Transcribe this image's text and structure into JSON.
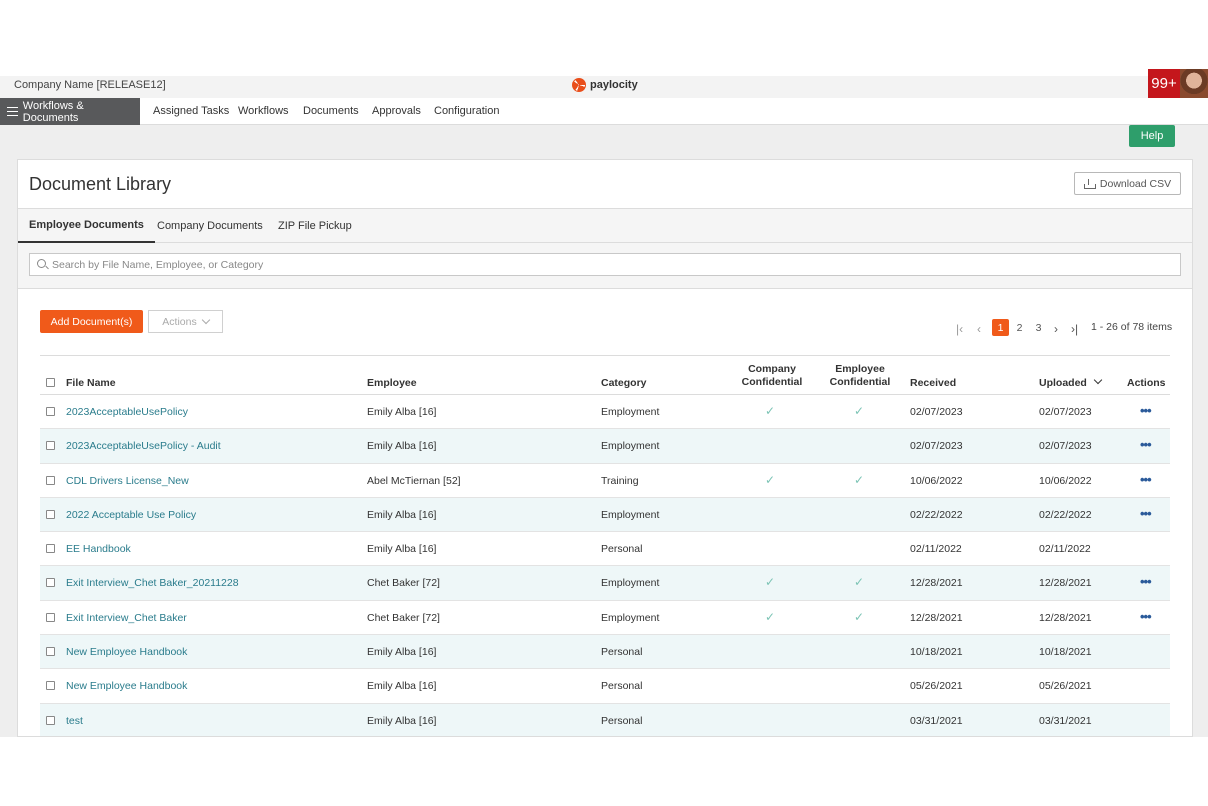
{
  "topbar": {
    "company_name": "Company Name [RELEASE12]",
    "logo_text": "paylocity",
    "notification_count": "99+"
  },
  "nav": {
    "primary": "Workflows & Documents",
    "items": [
      "Assigned Tasks",
      "Workflows",
      "Documents",
      "Approvals",
      "Configuration"
    ]
  },
  "help_label": "Help",
  "page": {
    "title": "Document Library",
    "download_label": "Download CSV"
  },
  "tabs": [
    "Employee Documents",
    "Company Documents",
    "ZIP File Pickup"
  ],
  "search": {
    "placeholder": "Search by File Name, Employee, or Category"
  },
  "toolbar": {
    "add_label": "Add Document(s)",
    "actions_label": "Actions"
  },
  "pagination": {
    "pages": [
      "1",
      "2",
      "3"
    ],
    "current": "1",
    "info": "1 - 26 of 78 items"
  },
  "table": {
    "headers": {
      "file_name": "File Name",
      "employee": "Employee",
      "category": "Category",
      "company_conf_1": "Company",
      "company_conf_2": "Confidential",
      "employee_conf_1": "Employee",
      "employee_conf_2": "Confidential",
      "received": "Received",
      "uploaded": "Uploaded",
      "actions": "Actions"
    },
    "rows": [
      {
        "file": "2023AcceptableUsePolicy",
        "employee": "Emily Alba [16]",
        "category": "Employment",
        "company_conf": true,
        "employee_conf": true,
        "received": "02/07/2023",
        "uploaded": "02/07/2023",
        "actions": true
      },
      {
        "file": "2023AcceptableUsePolicy - Audit",
        "employee": "Emily Alba [16]",
        "category": "Employment",
        "company_conf": false,
        "employee_conf": false,
        "received": "02/07/2023",
        "uploaded": "02/07/2023",
        "actions": true
      },
      {
        "file": "CDL Drivers License_New",
        "employee": "Abel McTiernan [52]",
        "category": "Training",
        "company_conf": true,
        "employee_conf": true,
        "received": "10/06/2022",
        "uploaded": "10/06/2022",
        "actions": true
      },
      {
        "file": "2022 Acceptable Use Policy",
        "employee": "Emily Alba [16]",
        "category": "Employment",
        "company_conf": false,
        "employee_conf": false,
        "received": "02/22/2022",
        "uploaded": "02/22/2022",
        "actions": true
      },
      {
        "file": "EE Handbook",
        "employee": "Emily Alba [16]",
        "category": "Personal",
        "company_conf": false,
        "employee_conf": false,
        "received": "02/11/2022",
        "uploaded": "02/11/2022",
        "actions": false
      },
      {
        "file": "Exit Interview_Chet Baker_20211228",
        "employee": "Chet Baker [72]",
        "category": "Employment",
        "company_conf": true,
        "employee_conf": true,
        "received": "12/28/2021",
        "uploaded": "12/28/2021",
        "actions": true
      },
      {
        "file": "Exit Interview_Chet Baker",
        "employee": "Chet Baker [72]",
        "category": "Employment",
        "company_conf": true,
        "employee_conf": true,
        "received": "12/28/2021",
        "uploaded": "12/28/2021",
        "actions": true
      },
      {
        "file": "New Employee Handbook",
        "employee": "Emily Alba [16]",
        "category": "Personal",
        "company_conf": false,
        "employee_conf": false,
        "received": "10/18/2021",
        "uploaded": "10/18/2021",
        "actions": false
      },
      {
        "file": "New Employee Handbook",
        "employee": "Emily Alba [16]",
        "category": "Personal",
        "company_conf": false,
        "employee_conf": false,
        "received": "05/26/2021",
        "uploaded": "05/26/2021",
        "actions": false
      },
      {
        "file": "test",
        "employee": "Emily Alba [16]",
        "category": "Personal",
        "company_conf": false,
        "employee_conf": false,
        "received": "03/31/2021",
        "uploaded": "03/31/2021",
        "actions": false
      }
    ]
  },
  "colors": {
    "accent_orange": "#f05a1a",
    "help_green": "#2e9e6b",
    "link_teal": "#2a7c8c",
    "row_alt": "#eef7f8"
  }
}
